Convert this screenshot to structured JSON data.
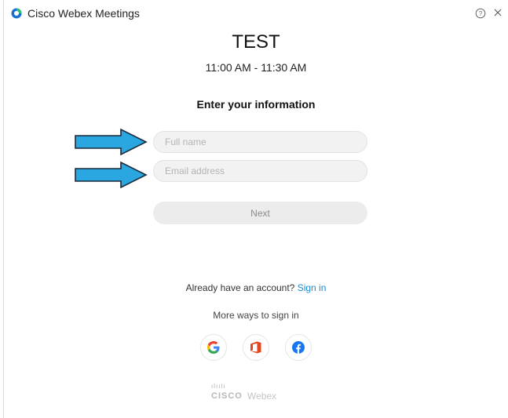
{
  "window": {
    "app_title": "Cisco Webex Meetings"
  },
  "meeting": {
    "title": "TEST",
    "time": "11:00 AM - 11:30 AM"
  },
  "form": {
    "heading": "Enter your information",
    "full_name_placeholder": "Full name",
    "email_placeholder": "Email address",
    "full_name_value": "",
    "email_value": "",
    "next_label": "Next"
  },
  "signin": {
    "prompt": "Already have an account?",
    "link_label": "Sign in",
    "more_ways": "More ways to sign in",
    "providers": [
      "google-icon",
      "office-icon",
      "facebook-icon"
    ]
  },
  "footer": {
    "brand_bars": "ılıılı",
    "brand_cisco": "CISCO",
    "brand_webex": "Webex"
  },
  "annotations": {
    "arrow_color": "#2aa7e0"
  },
  "colors": {
    "link": "#1a8bd6",
    "webex_logo_blue": "#1b6fd1",
    "webex_logo_green": "#2fbf71",
    "office_red": "#e5441f",
    "facebook_blue": "#1877f2"
  }
}
